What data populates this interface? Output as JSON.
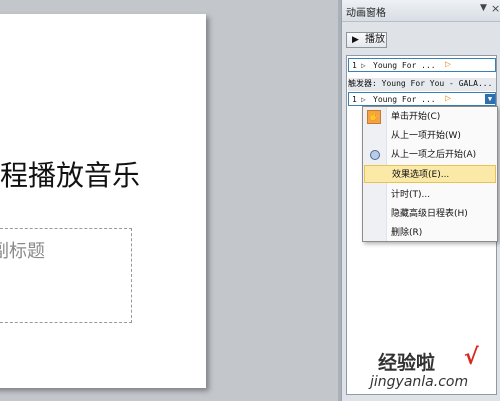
{
  "slide": {
    "title": "程播放音乐",
    "subtitle_placeholder": "副标题"
  },
  "animation_pane": {
    "title": "动画窗格",
    "play_button": {
      "icon": "play-icon",
      "label": "播放"
    },
    "items": [
      {
        "number": "1",
        "name": "Young For ...",
        "trigger_icon": "mouse-click-icon"
      },
      {
        "number": "1",
        "name": "Young For ...",
        "trigger_icon": "mouse-click-icon",
        "selected": true
      }
    ],
    "trigger_label": "触发器: Young For You - GALA..."
  },
  "context_menu": {
    "items": [
      {
        "label": "单击开始(C)",
        "icon": "mouse-click-icon"
      },
      {
        "label": "从上一项开始(W)"
      },
      {
        "label": "从上一项之后开始(A)",
        "icon": "clock-icon"
      },
      {
        "label": "效果选项(E)...",
        "highlighted": true
      },
      {
        "label": "计时(T)..."
      },
      {
        "label": "隐藏高级日程表(H)"
      },
      {
        "label": "删除(R)"
      }
    ]
  },
  "watermark": {
    "title": "经验啦",
    "check_mark": "√",
    "url": "jingyanla.com"
  },
  "colors": {
    "background": "#c3c7cc",
    "selection_border": "#3c7fb1",
    "menu_highlight": "#fbe9a8",
    "play_indicator": "#e89a3c",
    "watermark_check": "#d9261c"
  }
}
